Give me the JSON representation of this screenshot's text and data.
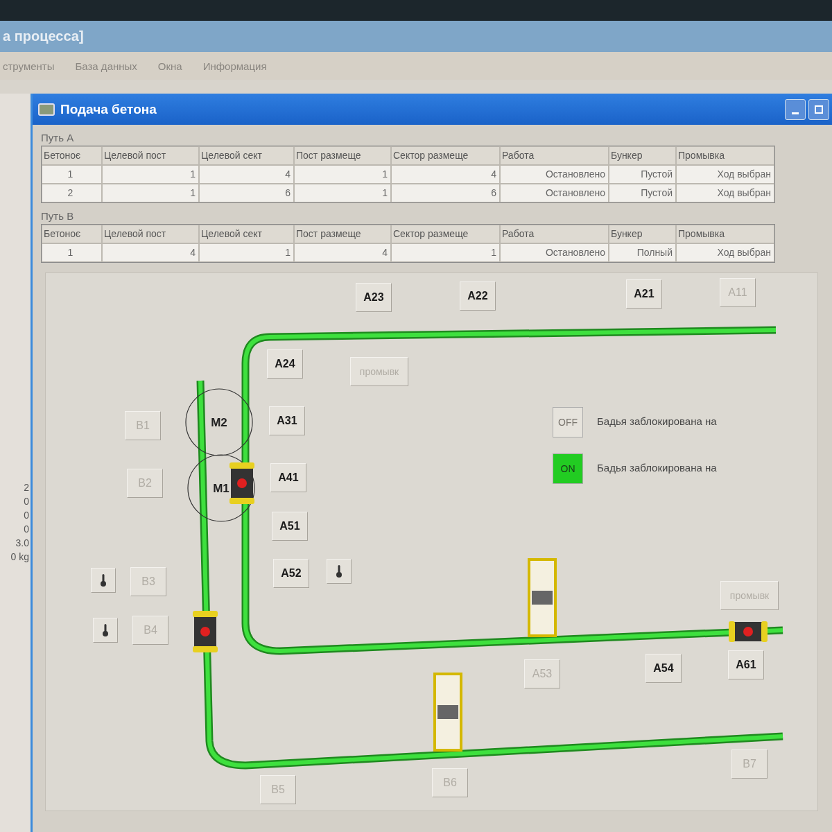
{
  "app": {
    "title": "а процесса]",
    "menu": [
      "струменты",
      "База данных",
      "Окна",
      "Информация"
    ]
  },
  "side_panel": {
    "values": [
      "2",
      "0",
      "0",
      "0",
      "3.0",
      "0 kg"
    ]
  },
  "window": {
    "title": "Подача бетона"
  },
  "path_a": {
    "label": "Путь А",
    "columns": [
      "Бетоноє",
      "Целевой пост",
      "Целевой сект",
      "Пост размеще",
      "Сектор размеще",
      "Работа",
      "Бункер",
      "Промывка"
    ],
    "rows": [
      [
        "1",
        "1",
        "4",
        "1",
        "4",
        "Остановлено",
        "Пустой",
        "Ход выбран"
      ],
      [
        "2",
        "1",
        "6",
        "1",
        "6",
        "Остановлено",
        "Пустой",
        "Ход выбран"
      ]
    ]
  },
  "path_b": {
    "label": "Путь В",
    "columns": [
      "Бетоноє",
      "Целевой пост",
      "Целевой сект",
      "Пост размеще",
      "Сектор размеще",
      "Работа",
      "Бункер",
      "Промывка"
    ],
    "rows": [
      [
        "1",
        "4",
        "1",
        "4",
        "1",
        "Остановлено",
        "Полный",
        "Ход выбран"
      ]
    ]
  },
  "diagram": {
    "stations": [
      {
        "kind": "station",
        "label": "A23",
        "enabled": true
      },
      {
        "kind": "station",
        "label": "A22",
        "enabled": true
      },
      {
        "kind": "station",
        "label": "A21",
        "enabled": true
      },
      {
        "kind": "station",
        "label": "A11",
        "enabled": false
      },
      {
        "kind": "station",
        "label": "A24",
        "enabled": true
      },
      {
        "kind": "wash",
        "label": "промывк",
        "enabled": false
      },
      {
        "kind": "station",
        "label": "A31",
        "enabled": true
      },
      {
        "kind": "station",
        "label": "A41",
        "enabled": true
      },
      {
        "kind": "station",
        "label": "A51",
        "enabled": true
      },
      {
        "kind": "station",
        "label": "A52",
        "enabled": true
      },
      {
        "kind": "thermometer",
        "enabled": true
      },
      {
        "kind": "station",
        "label": "B1",
        "enabled": false
      },
      {
        "kind": "station",
        "label": "B2",
        "enabled": false
      },
      {
        "kind": "thermometer",
        "enabled": true
      },
      {
        "kind": "station",
        "label": "B3",
        "enabled": false
      },
      {
        "kind": "thermometer",
        "enabled": true
      },
      {
        "kind": "station",
        "label": "B4",
        "enabled": false
      },
      {
        "kind": "wash",
        "label": "промывк",
        "enabled": false
      },
      {
        "kind": "station",
        "label": "A53",
        "enabled": false
      },
      {
        "kind": "station",
        "label": "A54",
        "enabled": true
      },
      {
        "kind": "station",
        "label": "A61",
        "enabled": true
      },
      {
        "kind": "station",
        "label": "B5",
        "enabled": false
      },
      {
        "kind": "station",
        "label": "B6",
        "enabled": false
      },
      {
        "kind": "station",
        "label": "B7",
        "enabled": false
      }
    ],
    "motors": [
      {
        "label": "M2"
      },
      {
        "label": "M1"
      }
    ],
    "locks": [
      {
        "label": "OFF",
        "on": false,
        "text": "Бадья заблокирована на"
      },
      {
        "label": "ON",
        "on": true,
        "text": "Бадья заблокирована на"
      }
    ]
  }
}
